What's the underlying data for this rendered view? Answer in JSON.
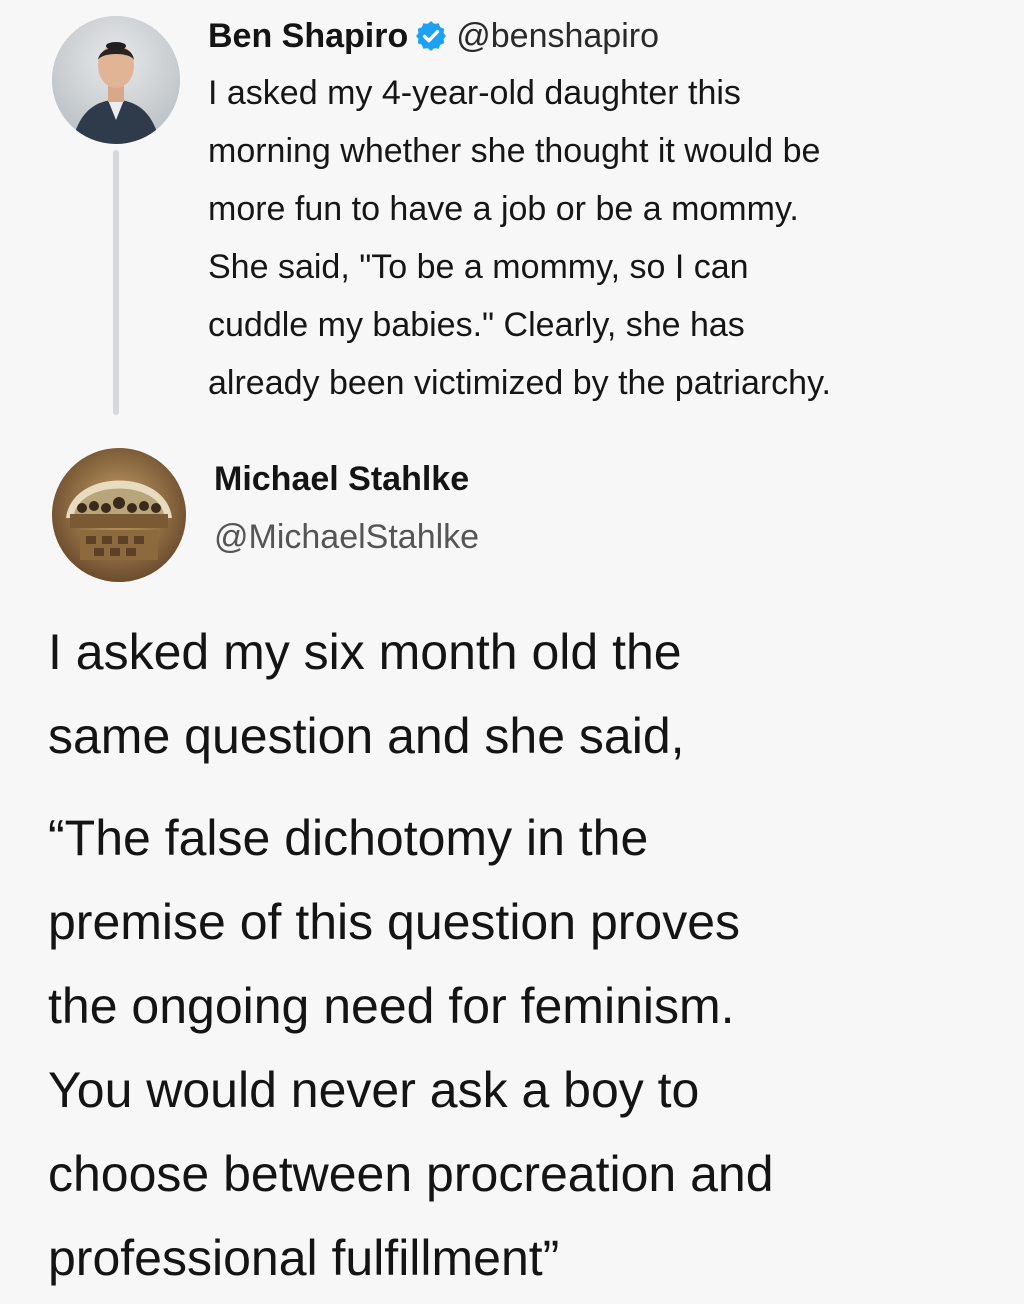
{
  "tweet_1": {
    "display_name": "Ben Shapiro",
    "handle": "@benshapiro",
    "verified_icon": "verified-badge-icon",
    "body_lines": [
      "I asked my 4-year-old daughter this",
      "morning whether she thought it would be",
      "more fun to have a job or be a mommy.",
      "She said, \"To be a mommy, so I can",
      "cuddle my babies.\" Clearly, she has",
      "already been victimized by the patriarchy."
    ]
  },
  "tweet_2": {
    "display_name": "Michael Stahlke",
    "handle": "@MichaelStahlke",
    "paragraph_1": [
      "I asked my six month old the",
      "same question and she said,"
    ],
    "paragraph_2": [
      "“The false dichotomy in the",
      "premise of this question proves",
      "the ongoing need for feminism.",
      "You would never ask a boy to",
      "choose between procreation and",
      "professional fulfillment”"
    ]
  },
  "colors": {
    "background": "#f7f7f7",
    "verified_blue": "#1da1f2",
    "thread_line": "#d6d9dc"
  }
}
